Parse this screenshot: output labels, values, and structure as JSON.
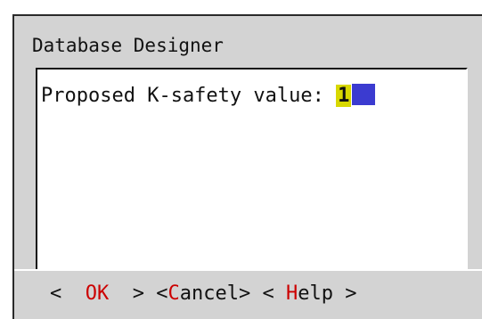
{
  "dialog": {
    "title": "Database Designer",
    "prompt_label": "Proposed K-safety value:",
    "value": "1"
  },
  "buttons": {
    "ok": {
      "open": "<",
      "hot": "OK",
      "close": ">"
    },
    "cancel": {
      "open": "<",
      "hot": "C",
      "rest": "ancel",
      "close": ">"
    },
    "help": {
      "open": "<",
      "hot": "H",
      "rest": "elp",
      "close": ">"
    }
  },
  "colors": {
    "dialog_bg": "#d3d3d3",
    "hotkey": "#cc0000",
    "value_highlight": "#d8d800",
    "cursor": "#3b3bd0"
  }
}
